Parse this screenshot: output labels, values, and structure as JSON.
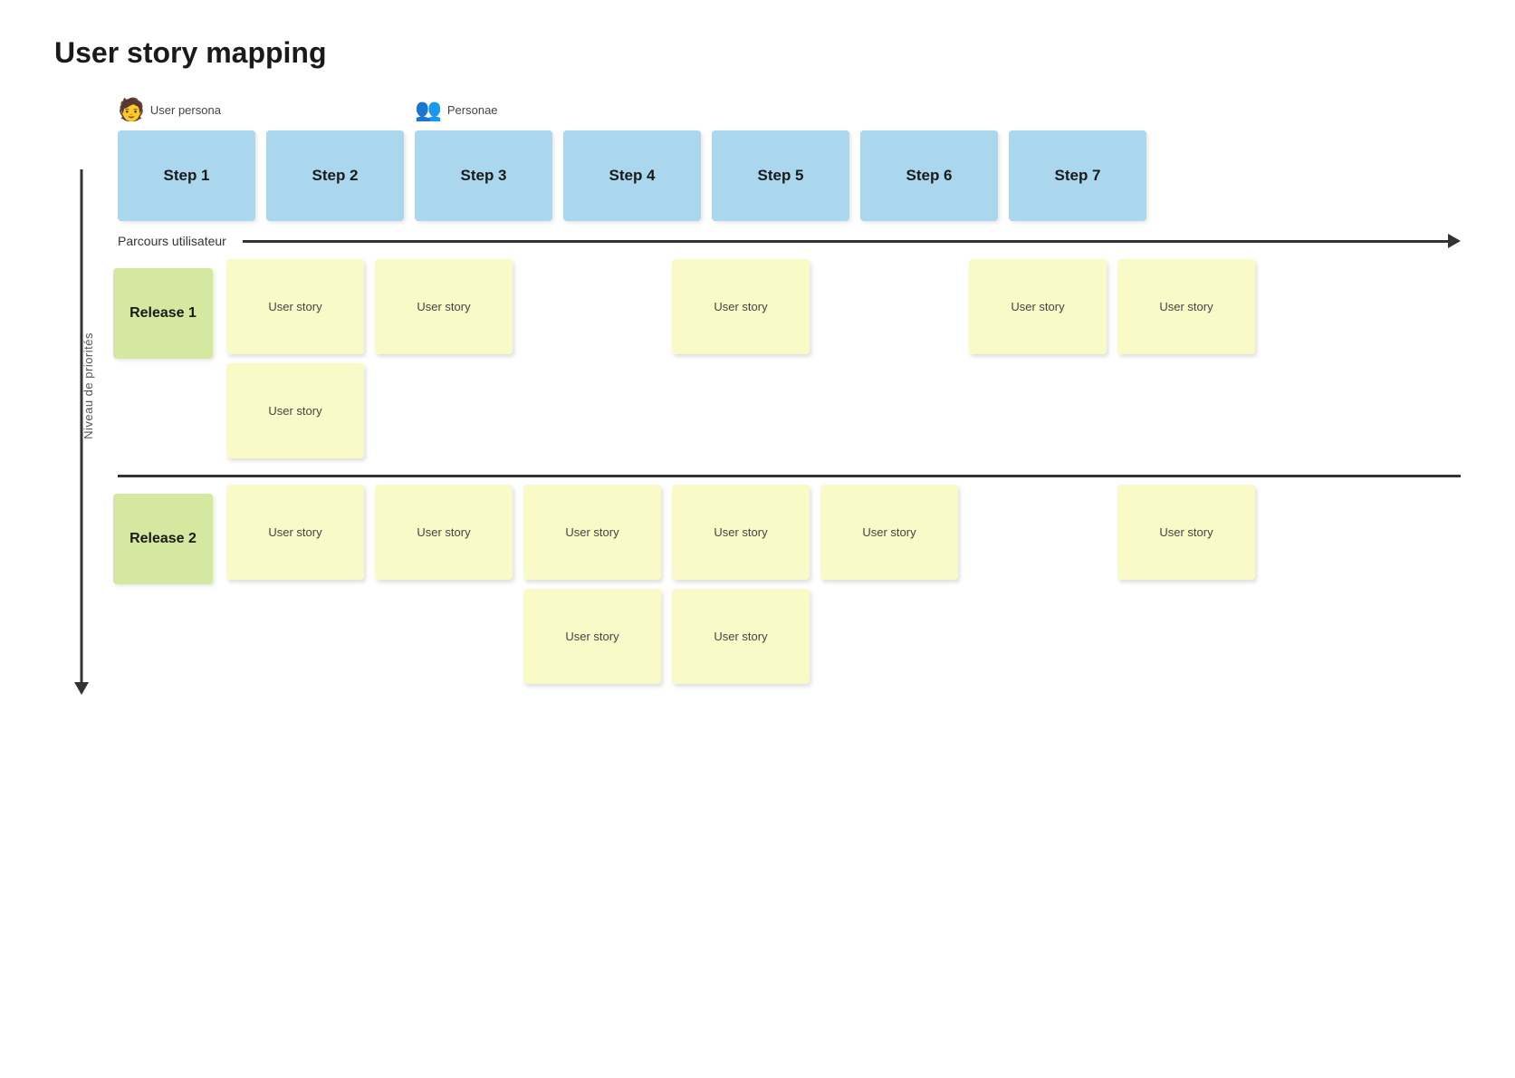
{
  "title": "User story mapping",
  "personas": [
    {
      "id": "persona1",
      "label": "User persona",
      "icon": "👤",
      "offset": 0
    },
    {
      "id": "persona2",
      "label": "Personae",
      "icon": "👥",
      "offset": 2
    }
  ],
  "steps": [
    {
      "id": "step1",
      "label": "Step 1"
    },
    {
      "id": "step2",
      "label": "Step 2"
    },
    {
      "id": "step3",
      "label": "Step 3"
    },
    {
      "id": "step4",
      "label": "Step 4"
    },
    {
      "id": "step5",
      "label": "Step 5"
    },
    {
      "id": "step6",
      "label": "Step 6"
    },
    {
      "id": "step7",
      "label": "Step 7"
    }
  ],
  "journey_label": "Parcours utilisateur",
  "v_axis_label": "Niveau de priorités",
  "releases": [
    {
      "id": "release1",
      "label": "Release 1",
      "rows": [
        [
          {
            "text": "User story",
            "visible": true
          },
          {
            "text": "User story",
            "visible": true
          },
          {
            "text": "",
            "visible": false
          },
          {
            "text": "User story",
            "visible": true
          },
          {
            "text": "",
            "visible": false
          },
          {
            "text": "User story",
            "visible": true
          },
          {
            "text": "User story",
            "visible": true
          }
        ],
        [
          {
            "text": "User story",
            "visible": true
          },
          {
            "text": "",
            "visible": false
          },
          {
            "text": "",
            "visible": false
          },
          {
            "text": "",
            "visible": false
          },
          {
            "text": "",
            "visible": false
          },
          {
            "text": "",
            "visible": false
          },
          {
            "text": "",
            "visible": false
          }
        ]
      ]
    },
    {
      "id": "release2",
      "label": "Release 2",
      "rows": [
        [
          {
            "text": "User story",
            "visible": true
          },
          {
            "text": "User story",
            "visible": true
          },
          {
            "text": "User story",
            "visible": true
          },
          {
            "text": "User story",
            "visible": true
          },
          {
            "text": "User story",
            "visible": true
          },
          {
            "text": "",
            "visible": false
          },
          {
            "text": "User story",
            "visible": true
          }
        ],
        [
          {
            "text": "",
            "visible": false
          },
          {
            "text": "",
            "visible": false
          },
          {
            "text": "User story",
            "visible": true
          },
          {
            "text": "User story",
            "visible": true
          },
          {
            "text": "",
            "visible": false
          },
          {
            "text": "",
            "visible": false
          },
          {
            "text": "",
            "visible": false
          }
        ]
      ]
    }
  ]
}
